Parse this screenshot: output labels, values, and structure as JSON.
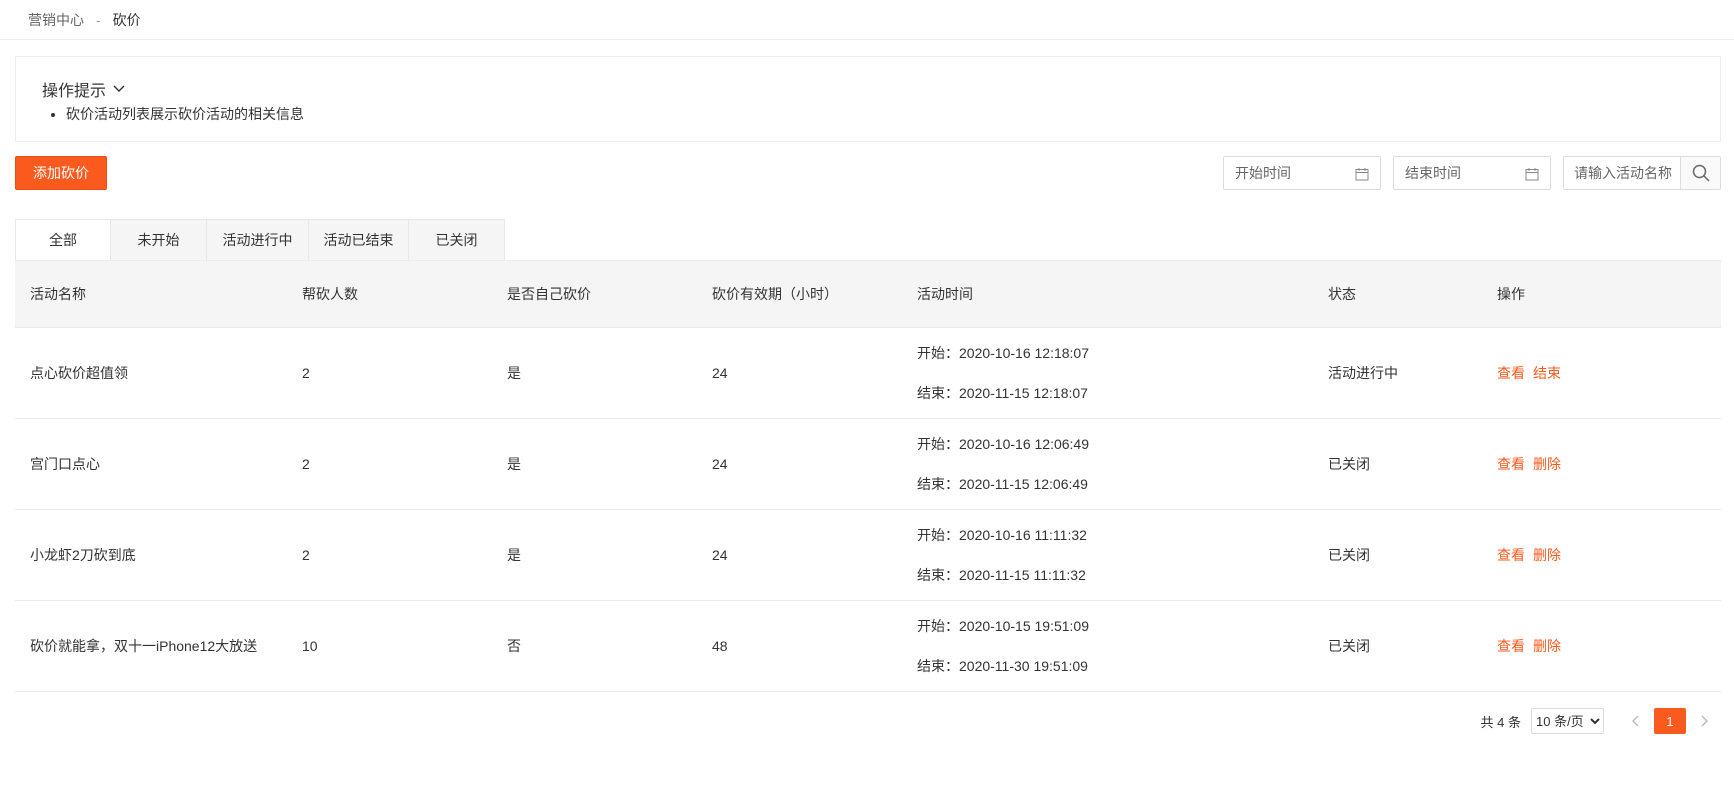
{
  "breadcrumb": {
    "root": "营销中心",
    "separator": "-",
    "current": "砍价"
  },
  "tips": {
    "title": "操作提示",
    "items": [
      "砍价活动列表展示砍价活动的相关信息"
    ]
  },
  "toolbar": {
    "add_label": "添加砍价",
    "start_placeholder": "开始时间",
    "end_placeholder": "结束时间",
    "search_placeholder": "请输入活动名称"
  },
  "tabs": [
    {
      "label": "全部",
      "active": true
    },
    {
      "label": "未开始",
      "active": false
    },
    {
      "label": "活动进行中",
      "active": false
    },
    {
      "label": "活动已结束",
      "active": false
    },
    {
      "label": "已关闭",
      "active": false
    }
  ],
  "table": {
    "columns": [
      "活动名称",
      "帮砍人数",
      "是否自己砍价",
      "砍价有效期（小时）",
      "活动时间",
      "状态",
      "操作"
    ],
    "rows": [
      {
        "name": "点心砍价超值领",
        "helpers": "2",
        "self_cut": "是",
        "validity": "24",
        "start": "开始：2020-10-16 12:18:07",
        "end": "结束：2020-11-15 12:18:07",
        "status": "活动进行中",
        "action1": "查看",
        "action2": "结束"
      },
      {
        "name": "宫门口点心",
        "helpers": "2",
        "self_cut": "是",
        "validity": "24",
        "start": "开始：2020-10-16 12:06:49",
        "end": "结束：2020-11-15 12:06:49",
        "status": "已关闭",
        "action1": "查看",
        "action2": "删除"
      },
      {
        "name": "小龙虾2刀砍到底",
        "helpers": "2",
        "self_cut": "是",
        "validity": "24",
        "start": "开始：2020-10-16 11:11:32",
        "end": "结束：2020-11-15 11:11:32",
        "status": "已关闭",
        "action1": "查看",
        "action2": "删除"
      },
      {
        "name": "砍价就能拿，双十一iPhone12大放送",
        "helpers": "10",
        "self_cut": "否",
        "validity": "48",
        "start": "开始：2020-10-15 19:51:09",
        "end": "结束：2020-11-30 19:51:09",
        "status": "已关闭",
        "action1": "查看",
        "action2": "删除"
      }
    ]
  },
  "pagination": {
    "total_text": "共 4 条",
    "page_size": "10 条/页",
    "current_page": "1"
  },
  "colors": {
    "accent": "#fa5a1e",
    "header_bg": "#f5f5f5",
    "border": "#e8e8e8"
  },
  "icons": [
    "chevron-down-icon",
    "calendar-icon",
    "search-icon",
    "chevron-left-icon",
    "chevron-right-icon"
  ]
}
